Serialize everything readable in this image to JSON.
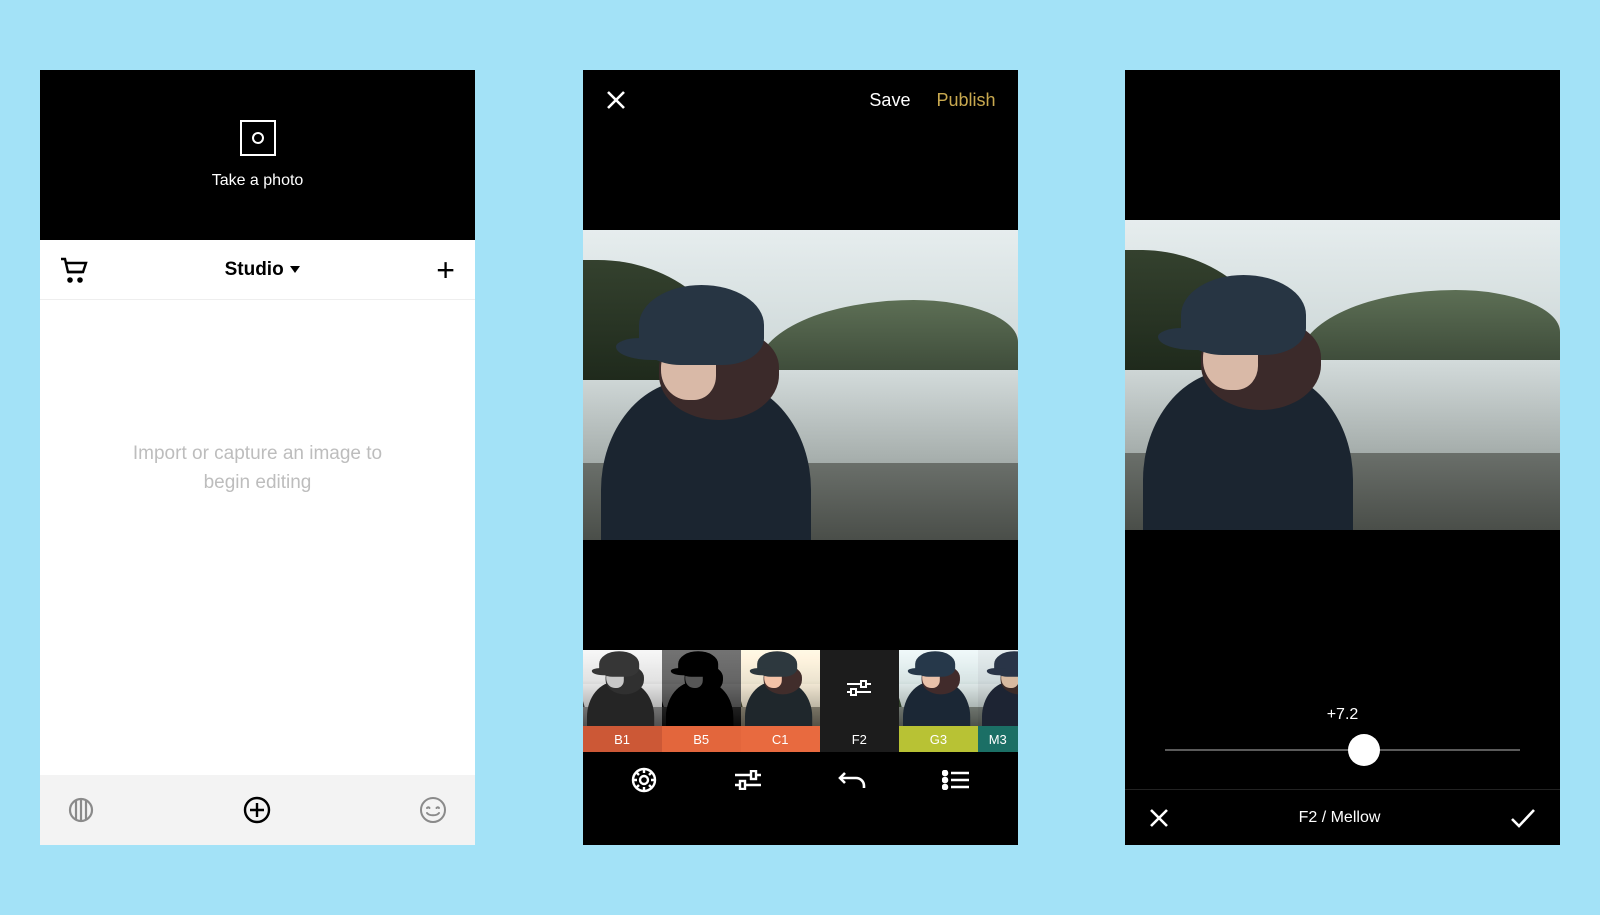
{
  "screen1": {
    "take_photo_label": "Take a photo",
    "studio_label": "Studio",
    "empty_text": "Import or capture an image to begin editing"
  },
  "screen2": {
    "save_label": "Save",
    "publish_label": "Publish",
    "filters": {
      "b1": "B1",
      "b5": "B5",
      "c1": "C1",
      "f2": "F2",
      "g3": "G3",
      "m3": "M3"
    }
  },
  "screen3": {
    "slider_value": "+7.2",
    "filter_caption": "F2 / Mellow"
  }
}
